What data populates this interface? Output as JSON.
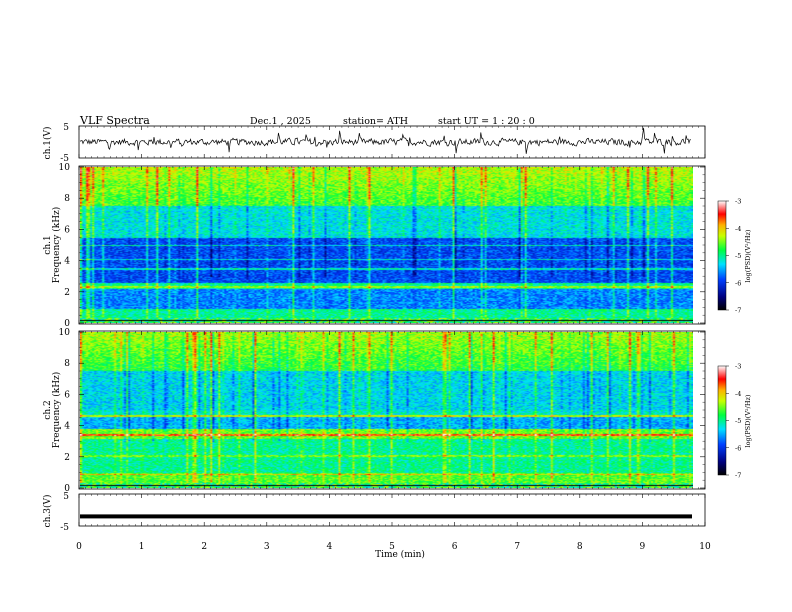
{
  "header": {
    "title": "VLF  Spectra",
    "date": "Dec.1  , 2025",
    "station": "station= ATH",
    "start_ut": "start  UT  =   1  : 20 : 0"
  },
  "chart_data": [
    {
      "type": "line",
      "id": "ch1-waveform",
      "ylabel": "ch.1(V)",
      "ylim": [
        -5,
        5
      ],
      "yticks": [
        "5",
        "-5"
      ],
      "xlim": [
        0,
        10
      ],
      "trace": "noisy signal around 0 V, approx -2 to +2 V, with spikes",
      "series": [
        {
          "approx_range": [
            -2.5,
            2.5
          ]
        }
      ]
    },
    {
      "type": "heatmap",
      "id": "ch1-spectrogram",
      "ylabel": "Frequency  (kHz)",
      "channel_label": "ch.1",
      "ylim": [
        0,
        10
      ],
      "yticks": [
        "0",
        "2",
        "4",
        "6",
        "8",
        "10"
      ],
      "xlim": [
        0,
        9.85
      ],
      "colorbar": {
        "label": "log(PSD)(V²/Hz)",
        "ticks": [
          "-3",
          "-4",
          "-5",
          "-6",
          "-7"
        ],
        "range": [
          -7,
          -3
        ]
      }
    },
    {
      "type": "heatmap",
      "id": "ch2-spectrogram",
      "ylabel": "Frequency  (kHz)",
      "channel_label": "ch.2",
      "ylim": [
        0,
        10
      ],
      "yticks": [
        "0",
        "2",
        "4",
        "6",
        "8",
        "10"
      ],
      "xlim": [
        0,
        9.85
      ],
      "colorbar": {
        "label": "log(PSD)(V²/Hz)",
        "ticks": [
          "-3",
          "-4",
          "-5",
          "-6",
          "-7"
        ],
        "range": [
          -7,
          -3
        ]
      }
    },
    {
      "type": "line",
      "id": "ch3-waveform",
      "ylabel": "ch.3(V)",
      "ylim": [
        -5,
        5
      ],
      "yticks": [
        "5",
        "-5"
      ],
      "xlim": [
        0,
        10
      ],
      "series": [
        {
          "approx_value": -2.0
        }
      ]
    }
  ],
  "xaxis": {
    "label": "Time  (min)",
    "ticks": [
      "0",
      "1",
      "2",
      "3",
      "4",
      "5",
      "6",
      "7",
      "8",
      "9",
      "10"
    ],
    "range": [
      0,
      10
    ]
  }
}
